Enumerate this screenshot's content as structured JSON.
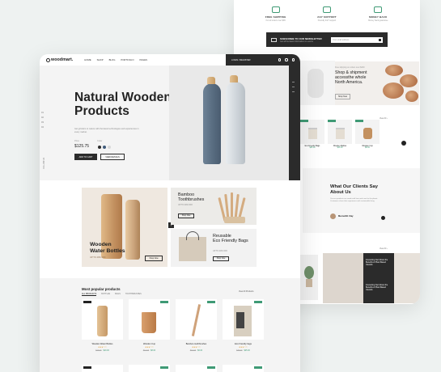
{
  "back": {
    "features": [
      {
        "title": "FREE SHIPPING",
        "sub": "For all orders over $99"
      },
      {
        "title": "24/7 SUPPORT",
        "sub": "Friendly 24/7 support"
      },
      {
        "title": "MONEY BACK",
        "sub": "Money back guarantee"
      }
    ],
    "newsletter": {
      "title": "SUBSCRIBE TO OUR NEWSLETTER",
      "sub": "Get all the latest information on events",
      "placeholder": "Your email address"
    },
    "shipping": {
      "tiny": "Free shipping on orders over $200",
      "heading": "Shop & shipment accessthe whole North America.",
      "button": "Shop Now"
    },
    "bags": [
      {
        "name": "Eco Friendly Bags",
        "price": "$25.00"
      },
      {
        "name": "Wooden Rattles",
        "price": "$15.00"
      },
      {
        "name": "Wooden Cup",
        "price": "$8.00"
      }
    ],
    "clients": {
      "heading": "What Our Clients Say About Us",
      "text": "Our eco products are made with love and care for the planet. Customers share their experience with sustainable living.",
      "name": "Mercedith Clay"
    },
    "spoon_text": "Interesting Fact About the Benefits of Plant Based Utensils"
  },
  "nav": {
    "logo": "woodmart.",
    "menu": [
      "HOME",
      "SHOP",
      "BLOG",
      "PORTFOLIO",
      "PAGES"
    ],
    "login": "LOGIN / REGISTER"
  },
  "hero": {
    "title_line1": "Natural Wooden",
    "title_line2": "Products",
    "desc": "Get grinders to nature with the latest technologies and experiences in every market.",
    "price_label": "Price",
    "price": "$125.75",
    "color_label": "Color",
    "cta_primary": "ADD TO CART",
    "cta_secondary": "VIEW DETAILS",
    "pager": [
      "01",
      "02",
      "03",
      "04"
    ],
    "vertical": "FOLLOW US"
  },
  "promos": {
    "bottles": {
      "title_line1": "Wooden",
      "title_line2": "Water Bottles",
      "sub": "UP TO 40% OFF",
      "button": "Shop Now"
    },
    "brushes": {
      "title_line1": "Bamboo",
      "title_line2": "Toothbrushes",
      "sub": "UP TO 40% OFF",
      "button": "Shop Now"
    },
    "bags": {
      "title_line1": "Reusable",
      "title_line2": "Eco Friendly Bags",
      "sub": "UP TO 40% OFF",
      "button": "Shop Now"
    }
  },
  "popular": {
    "title": "Most popular products",
    "tabs": [
      "ALL PRODUCTS",
      "BOTTLES",
      "BAGS",
      "TOOTHBRUSHES"
    ],
    "view_all": "View All Products",
    "products": [
      {
        "name": "Wooden Water Bottles",
        "stars": "★★★☆☆",
        "old": "$29.00",
        "price": "$19.00"
      },
      {
        "name": "Wooden Cup",
        "stars": "★★★☆☆",
        "old": "$12.00",
        "price": "$8.00"
      },
      {
        "name": "Bamboo toothbrushes",
        "stars": "★★★☆☆",
        "old": "$10.00",
        "price": "$6.00"
      },
      {
        "name": "Eco Friendly bags",
        "stars": "★★★☆☆",
        "old": "$35.00",
        "price": "$25.00"
      }
    ]
  },
  "colors": {
    "accent": "#3f9a75",
    "dark": "#2b2b2b",
    "wood": "#c39160",
    "swatch1": "#2b2b2b",
    "swatch2": "#3f5a7a",
    "swatch3": "#d9d9d9"
  }
}
